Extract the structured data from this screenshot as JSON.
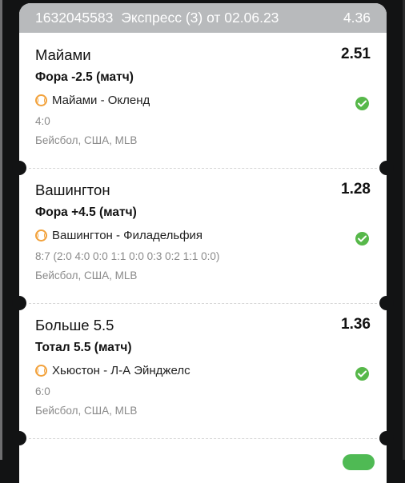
{
  "ticket": {
    "id": "1632045583",
    "type": "Экспресс (3) от 02.06.23",
    "total_coef": "4.36"
  },
  "bets": [
    {
      "pick": "Майами",
      "coef": "2.51",
      "market": "Фора -2.5 (матч)",
      "match": "Майами - Окленд",
      "score": "4:0",
      "league": "Бейсбол, США, MLB",
      "status": "won"
    },
    {
      "pick": "Вашингтон",
      "coef": "1.28",
      "market": "Фора +4.5 (матч)",
      "match": "Вашингтон - Филадельфия",
      "score": "8:7 (2:0 4:0 0:0 1:1 0:0 0:3 0:2 1:1 0:0)",
      "league": "Бейсбол, США, MLB",
      "status": "won"
    },
    {
      "pick": "Больше 5.5",
      "coef": "1.36",
      "market": "Тотал 5.5 (матч)",
      "match": "Хьюстон - Л-А Эйнджелс",
      "score": "6:0",
      "league": "Бейсбол, США, MLB",
      "status": "won"
    }
  ],
  "icons": {
    "sport": "baseball-icon",
    "status": "check-circle-icon"
  },
  "colors": {
    "header_bg": "#b8babc",
    "accent_orange": "#f2a23c",
    "success_green": "#57b84a"
  }
}
